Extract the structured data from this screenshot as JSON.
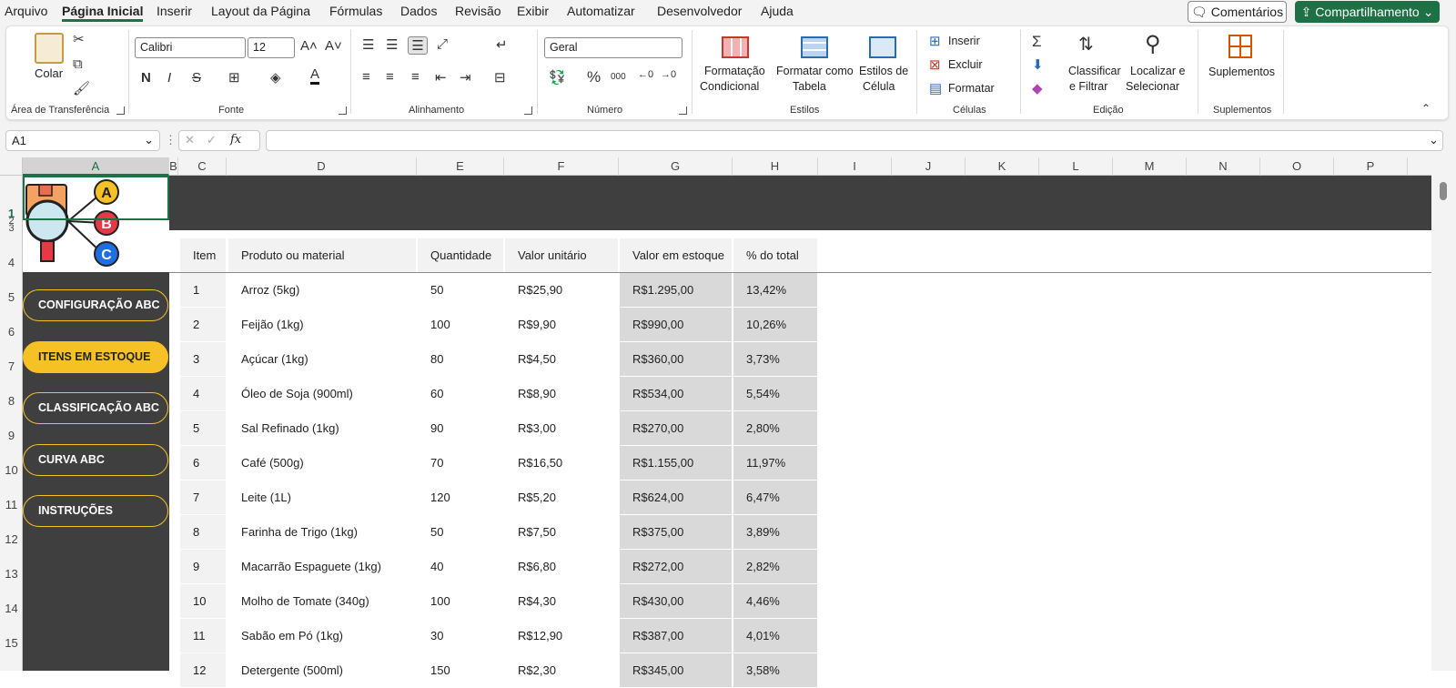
{
  "menu": {
    "items": [
      "Arquivo",
      "Página Inicial",
      "Inserir",
      "Layout da Página",
      "Fórmulas",
      "Dados",
      "Revisão",
      "Exibir",
      "Automatizar",
      "Desenvolvedor",
      "Ajuda"
    ],
    "comments": "Comentários",
    "share": "Compartilhamento"
  },
  "ribbon": {
    "clipboard": {
      "paste": "Colar",
      "group": "Área de Transferência"
    },
    "font": {
      "name": "Calibri",
      "size": "12",
      "bold": "N",
      "italic": "I",
      "strike": "S",
      "group": "Fonte"
    },
    "align": {
      "group": "Alinhamento"
    },
    "number": {
      "format": "Geral",
      "percent": "%",
      "thousands": "000",
      "group": "Número"
    },
    "styles": {
      "cond": "Formatação",
      "cond2": "Condicional",
      "table": "Formatar como",
      "table2": "Tabela",
      "cell": "Estilos de",
      "cell2": "Célula",
      "group": "Estilos"
    },
    "cells": {
      "insert": "Inserir",
      "delete": "Excluir",
      "format": "Formatar",
      "group": "Células"
    },
    "editing": {
      "sort": "Classificar",
      "sort2": "e Filtrar",
      "find": "Localizar e",
      "find2": "Selecionar",
      "group": "Edição"
    },
    "addins": {
      "label": "Suplementos",
      "group": "Suplementos"
    }
  },
  "formula": {
    "namebox": "A1",
    "fx": "fx",
    "value": ""
  },
  "columns": [
    "A",
    "B",
    "C",
    "D",
    "E",
    "F",
    "G",
    "H",
    "I",
    "J",
    "K",
    "L",
    "M",
    "N",
    "O",
    "P"
  ],
  "rows": [
    "1",
    "2",
    "3",
    "4",
    "5",
    "6",
    "7",
    "8",
    "9",
    "10",
    "11",
    "12",
    "13",
    "14",
    "15"
  ],
  "nav": [
    "CONFIGURAÇÃO ABC",
    "ITENS EM ESTOQUE",
    "CLASSIFICAÇÃO ABC",
    "CURVA ABC",
    "INSTRUÇÕES"
  ],
  "logo": {
    "letters": [
      "A",
      "B",
      "C"
    ]
  },
  "table": {
    "headers": [
      "Item",
      "Produto ou material",
      "Quantidade",
      "Valor unitário",
      "Valor em estoque",
      "% do total"
    ],
    "rows": [
      [
        "1",
        "Arroz (5kg)",
        "50",
        "R$25,90",
        "R$1.295,00",
        "13,42%"
      ],
      [
        "2",
        "Feijão (1kg)",
        "100",
        "R$9,90",
        "R$990,00",
        "10,26%"
      ],
      [
        "3",
        "Açúcar (1kg)",
        "80",
        "R$4,50",
        "R$360,00",
        "3,73%"
      ],
      [
        "4",
        "Óleo de Soja (900ml)",
        "60",
        "R$8,90",
        "R$534,00",
        "5,54%"
      ],
      [
        "5",
        "Sal Refinado (1kg)",
        "90",
        "R$3,00",
        "R$270,00",
        "2,80%"
      ],
      [
        "6",
        "Café (500g)",
        "70",
        "R$16,50",
        "R$1.155,00",
        "11,97%"
      ],
      [
        "7",
        "Leite (1L)",
        "120",
        "R$5,20",
        "R$624,00",
        "6,47%"
      ],
      [
        "8",
        "Farinha de Trigo (1kg)",
        "50",
        "R$7,50",
        "R$375,00",
        "3,89%"
      ],
      [
        "9",
        "Macarrão Espaguete (1kg)",
        "40",
        "R$6,80",
        "R$272,00",
        "2,82%"
      ],
      [
        "10",
        "Molho de Tomate (340g)",
        "100",
        "R$4,30",
        "R$430,00",
        "4,46%"
      ],
      [
        "11",
        "Sabão em Pó (1kg)",
        "30",
        "R$12,90",
        "R$387,00",
        "4,01%"
      ],
      [
        "12",
        "Detergente (500ml)",
        "150",
        "R$2,30",
        "R$345,00",
        "3,58%"
      ]
    ]
  }
}
